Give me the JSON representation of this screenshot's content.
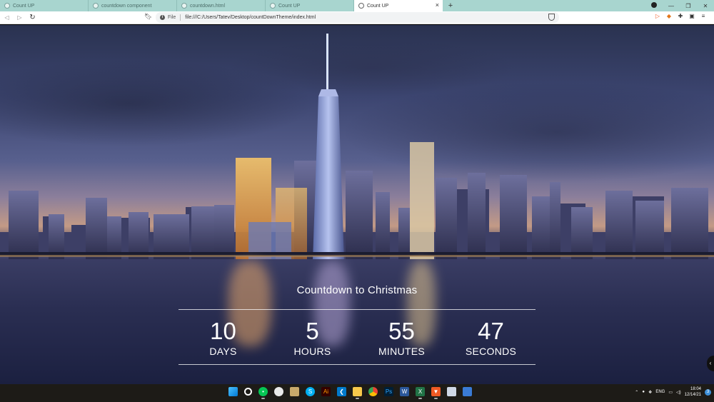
{
  "browser": {
    "tabs": [
      {
        "title": "Count UP",
        "active": false
      },
      {
        "title": "countdown component",
        "active": false
      },
      {
        "title": "countdown.html",
        "active": false
      },
      {
        "title": "Count UP",
        "active": false
      },
      {
        "title": "Count UP",
        "active": true
      }
    ],
    "new_tab_label": "+",
    "close_tab_label": "×",
    "url_scheme": "File",
    "url": "file:///C:/Users/Tatev/Desktop/countDownTheme/index.html"
  },
  "countdown": {
    "title": "Countdown to Christmas",
    "units": [
      {
        "value": "10",
        "label": "DAYS"
      },
      {
        "value": "5",
        "label": "HOURS"
      },
      {
        "value": "55",
        "label": "MINUTES"
      },
      {
        "value": "47",
        "label": "SECONDS"
      }
    ]
  },
  "taskbar": {
    "icons": [
      "windows-start-icon",
      "search-icon",
      "line-app-icon",
      "chromium-icon",
      "file-manager-icon",
      "skype-icon",
      "adobe-illustrator-icon",
      "vscode-icon",
      "folder-icon",
      "chrome-icon",
      "photoshop-icon",
      "word-icon",
      "excel-icon",
      "brave-icon",
      "photos-icon",
      "image-viewer-icon"
    ],
    "language": "ENG",
    "time": "18:04",
    "date": "12/14/21",
    "notification_count": "3"
  },
  "colors": {
    "tab_strip": "#a8d5cf",
    "taskbar": "#1d1b17",
    "countdown_text": "#ffffff",
    "brave_orange": "#f05a24"
  }
}
